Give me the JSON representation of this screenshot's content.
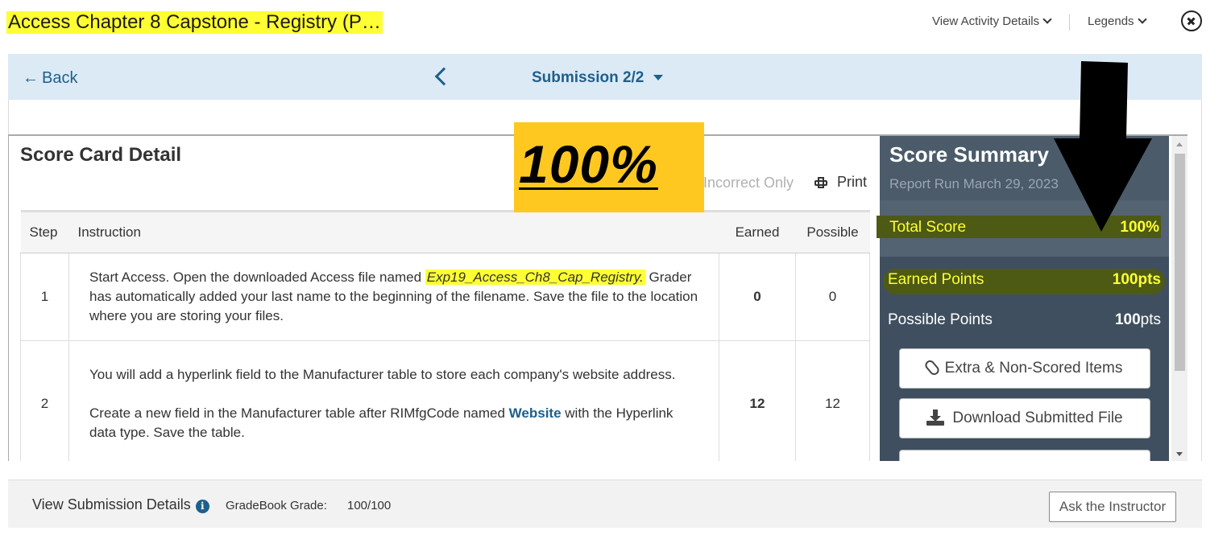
{
  "header": {
    "title": "Access Chapter 8 Capstone - Registry (P…",
    "view_activity": "View Activity Details",
    "legends": "Legends"
  },
  "nav": {
    "back": "Back",
    "submission": "Submission 2/2"
  },
  "annotation": {
    "badge": "100%"
  },
  "scorecard": {
    "title": "Score Card Detail",
    "incorrect_only": "Incorrect Only",
    "print": "Print",
    "columns": [
      "Step",
      "Instruction",
      "Earned",
      "Possible"
    ],
    "rows": [
      {
        "step": "1",
        "text_before": "Start Access. Open the downloaded Access file named ",
        "file": "Exp19_Access_Ch8_Cap_Registry.",
        "text_after": " Grader has automatically added your last name to the beginning of the filename. Save the file to the location where you are storing your files.",
        "earned": "0",
        "possible": "0"
      },
      {
        "step": "2",
        "para1": "You will add a hyperlink field to the Manufacturer table to store each company's website address.",
        "para2_before": "Create a new field in the Manufacturer table after RIMfgCode named ",
        "keyword": "Website",
        "para2_after": " with the Hyperlink data type. Save the table.",
        "earned": "12",
        "possible": "12"
      }
    ]
  },
  "summary": {
    "title": "Score Summary",
    "report_run": "Report Run March 29, 2023",
    "total_score_label": "Total Score",
    "total_score_value": "100%",
    "earned_label": "Earned Points",
    "earned_value": "100",
    "possible_label": "Possible Points",
    "possible_value": "100",
    "pts_unit": "pts",
    "extra_button": "Extra & Non-Scored Items",
    "download_button": "Download Submitted File"
  },
  "footer": {
    "view_submission": "View Submission Details",
    "gradebook_label": "GradeBook Grade:",
    "gradebook_value": "100/100",
    "ask_instructor": "Ask the Instructor"
  },
  "colors": {
    "nav_bg": "#dbeaf4",
    "link_blue": "#1e5f8c",
    "summary_bg": "#3f4f5f",
    "highlight_yellow": "#ffff33",
    "badge_yellow": "#ffc820"
  }
}
